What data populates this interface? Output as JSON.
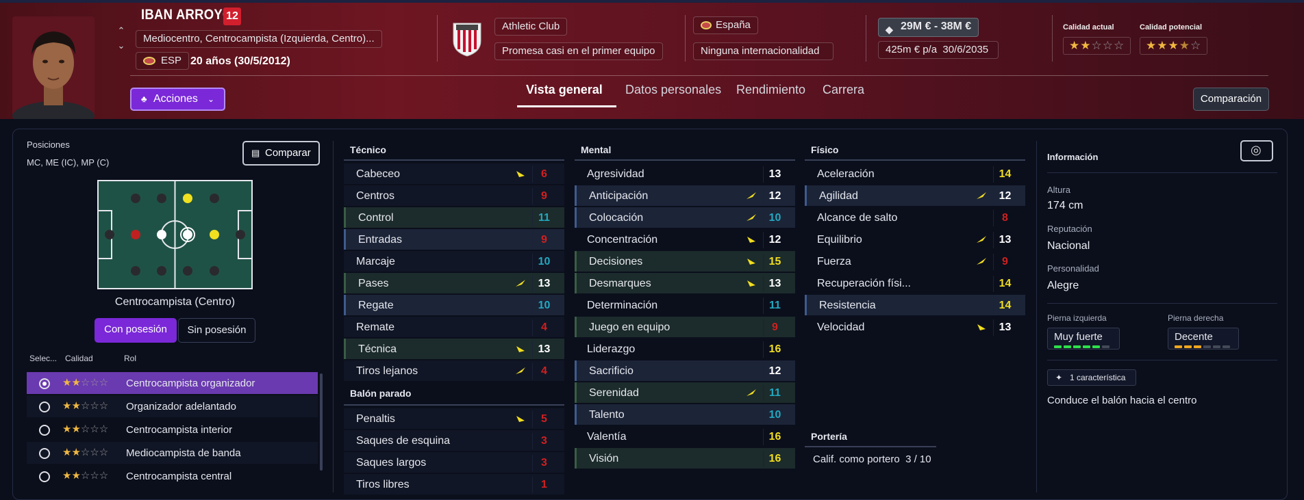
{
  "player": {
    "name": "IBAN ARROYO",
    "number": "12",
    "positions_long": "Mediocentro, Centrocampista (Izquierda, Centro)...",
    "nationality_code": "ESP",
    "age": "20 años (30/5/2012)"
  },
  "club": {
    "name": "Athletic Club",
    "status": "Promesa casi en el primer equipo"
  },
  "nation": {
    "country": "España",
    "international": "Ninguna internacionalidad"
  },
  "value": {
    "range": "29M € - 38M €",
    "wage": "425m € p/a",
    "contract_end": "30/6/2035"
  },
  "ratings": {
    "current_label": "Calidad actual",
    "current_stars": 2,
    "potential_label": "Calidad potencial",
    "potential_stars": 3.5
  },
  "actions_label": "Acciones",
  "tabs": [
    "Vista general",
    "Datos personales",
    "Rendimiento",
    "Carrera"
  ],
  "active_tab": 0,
  "compare_label": "Comparación",
  "left_panel": {
    "positions_title": "Posiciones",
    "positions_short": "MC, ME (IC), MP (C)",
    "compare_button": "Comparar",
    "pitch_caption": "Centrocampista (Centro)",
    "toggle": [
      "Con posesión",
      "Sin posesión"
    ],
    "table_headers": [
      "Selec...",
      "Calidad",
      "Rol"
    ],
    "roles": [
      {
        "label": "Centrocampista organizador",
        "stars": 2,
        "selected": true
      },
      {
        "label": "Organizador adelantado",
        "stars": 2,
        "selected": false
      },
      {
        "label": "Centrocampista interior",
        "stars": 2,
        "selected": false
      },
      {
        "label": "Mediocampista de banda",
        "stars": 2,
        "selected": false
      },
      {
        "label": "Centrocampista central",
        "stars": 2,
        "selected": false
      }
    ]
  },
  "technical": {
    "title": "Técnico",
    "rows": [
      {
        "label": "Cabeceo",
        "value": "6",
        "color": "red",
        "arrow": "up"
      },
      {
        "label": "Centros",
        "value": "9",
        "color": "red",
        "arrow": ""
      },
      {
        "label": "Control",
        "value": "11",
        "color": "teal",
        "arrow": ""
      },
      {
        "label": "Entradas",
        "value": "9",
        "color": "red",
        "arrow": ""
      },
      {
        "label": "Marcaje",
        "value": "10",
        "color": "teal",
        "arrow": ""
      },
      {
        "label": "Pases",
        "value": "13",
        "color": "white",
        "arrow": "fast"
      },
      {
        "label": "Regate",
        "value": "10",
        "color": "teal",
        "arrow": ""
      },
      {
        "label": "Remate",
        "value": "4",
        "color": "red",
        "arrow": ""
      },
      {
        "label": "Técnica",
        "value": "13",
        "color": "white",
        "arrow": "up"
      },
      {
        "label": "Tiros lejanos",
        "value": "4",
        "color": "red",
        "arrow": "fast"
      }
    ]
  },
  "set_pieces": {
    "title": "Balón parado",
    "rows": [
      {
        "label": "Penaltis",
        "value": "5",
        "color": "red",
        "arrow": "up"
      },
      {
        "label": "Saques de esquina",
        "value": "3",
        "color": "red",
        "arrow": ""
      },
      {
        "label": "Saques largos",
        "value": "3",
        "color": "red",
        "arrow": ""
      },
      {
        "label": "Tiros libres",
        "value": "1",
        "color": "red",
        "arrow": ""
      }
    ]
  },
  "mental": {
    "title": "Mental",
    "rows": [
      {
        "label": "Agresividad",
        "value": "13",
        "color": "white",
        "arrow": ""
      },
      {
        "label": "Anticipación",
        "value": "12",
        "color": "white",
        "arrow": "fast"
      },
      {
        "label": "Colocación",
        "value": "10",
        "color": "teal",
        "arrow": "fast"
      },
      {
        "label": "Concentración",
        "value": "12",
        "color": "white",
        "arrow": "up"
      },
      {
        "label": "Decisiones",
        "value": "15",
        "color": "yellow",
        "arrow": "up"
      },
      {
        "label": "Desmarques",
        "value": "13",
        "color": "white",
        "arrow": "up"
      },
      {
        "label": "Determinación",
        "value": "11",
        "color": "teal",
        "arrow": ""
      },
      {
        "label": "Juego en equipo",
        "value": "9",
        "color": "red",
        "arrow": ""
      },
      {
        "label": "Liderazgo",
        "value": "16",
        "color": "yellow",
        "arrow": ""
      },
      {
        "label": "Sacrificio",
        "value": "12",
        "color": "white",
        "arrow": ""
      },
      {
        "label": "Serenidad",
        "value": "11",
        "color": "teal",
        "arrow": "fast"
      },
      {
        "label": "Talento",
        "value": "10",
        "color": "teal",
        "arrow": ""
      },
      {
        "label": "Valentía",
        "value": "16",
        "color": "yellow",
        "arrow": ""
      },
      {
        "label": "Visión",
        "value": "16",
        "color": "yellow",
        "arrow": ""
      }
    ]
  },
  "physical": {
    "title": "Físico",
    "rows": [
      {
        "label": "Aceleración",
        "value": "14",
        "color": "yellow",
        "arrow": ""
      },
      {
        "label": "Agilidad",
        "value": "12",
        "color": "white",
        "arrow": "fast"
      },
      {
        "label": "Alcance de salto",
        "value": "8",
        "color": "red",
        "arrow": ""
      },
      {
        "label": "Equilibrio",
        "value": "13",
        "color": "white",
        "arrow": "fast"
      },
      {
        "label": "Fuerza",
        "value": "9",
        "color": "red",
        "arrow": "fast"
      },
      {
        "label": "Recuperación físi...",
        "value": "14",
        "color": "yellow",
        "arrow": ""
      },
      {
        "label": "Resistencia",
        "value": "14",
        "color": "yellow",
        "arrow": ""
      },
      {
        "label": "Velocidad",
        "value": "13",
        "color": "white",
        "arrow": "up"
      }
    ]
  },
  "goalkeeping": {
    "title": "Portería",
    "label": "Calif. como portero",
    "value": "3 / 10"
  },
  "info": {
    "title": "Información",
    "height_label": "Altura",
    "height": "174 cm",
    "reputation_label": "Reputación",
    "reputation": "Nacional",
    "personality_label": "Personalidad",
    "personality": "Alegre",
    "left_foot_label": "Pierna izquierda",
    "left_foot": "Muy fuerte",
    "left_foot_level": 5,
    "right_foot_label": "Pierna derecha",
    "right_foot": "Decente",
    "right_foot_level": 3,
    "traits_badge": "1 característica",
    "trait": "Conduce el balón hacia el centro"
  },
  "colors": {
    "accent_purple": "#7a28d8",
    "header_red": "#6e1622",
    "red": "#d02020",
    "teal": "#23a8c0",
    "yellow": "#f0dd20",
    "green_bar": "#2ee04a",
    "orange_bar": "#f0a820"
  }
}
